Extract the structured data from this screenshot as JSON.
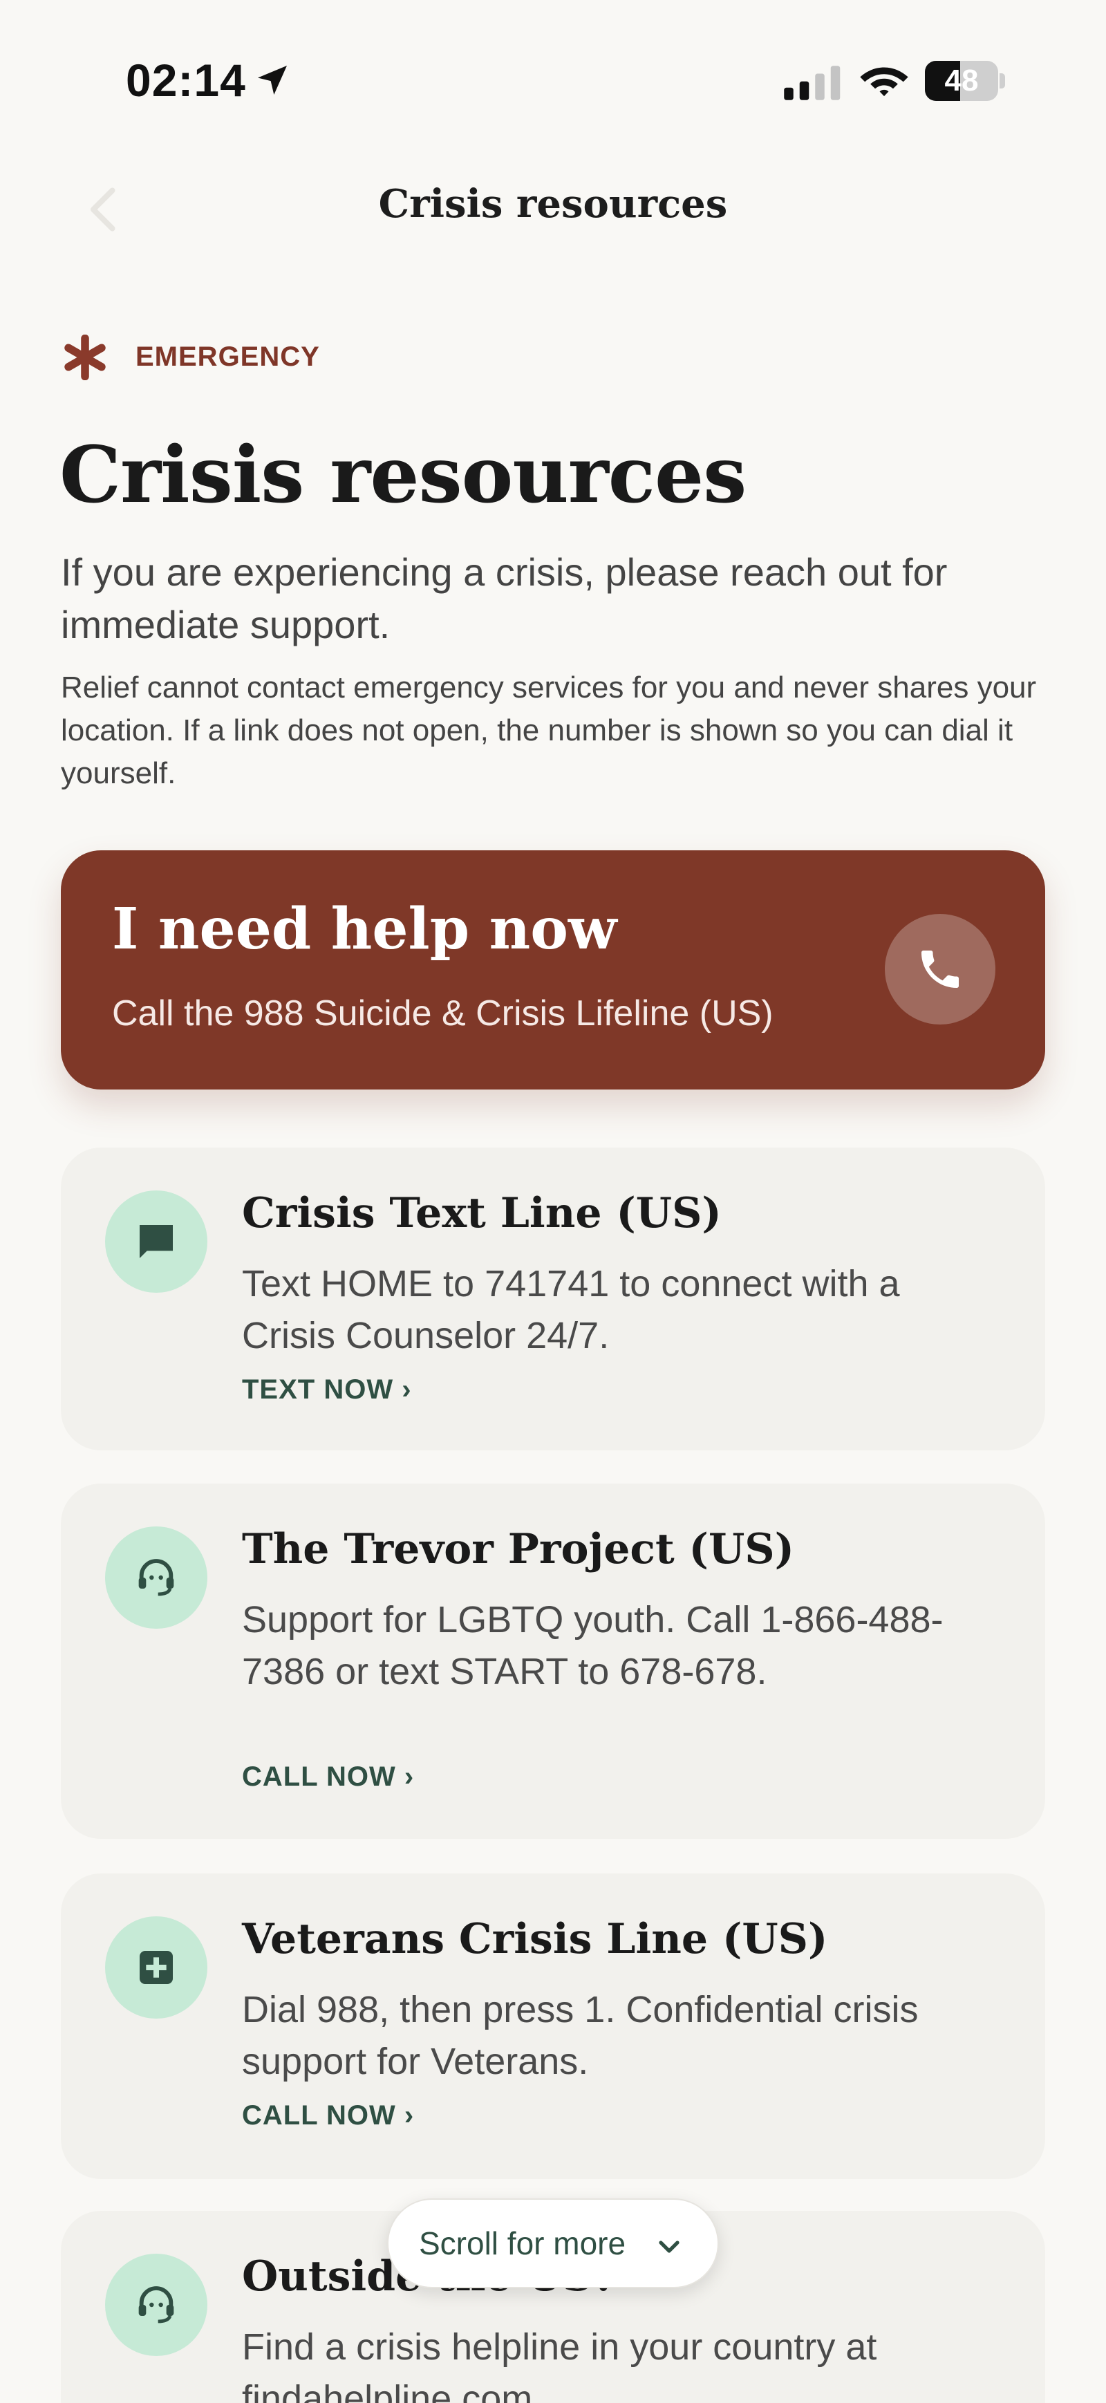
{
  "status_bar": {
    "time": "02:14",
    "battery": "48",
    "battery_level": 0.48,
    "icons": [
      "location-arrow-icon",
      "cellular-signal-icon",
      "wifi-icon",
      "battery-icon"
    ]
  },
  "nav": {
    "title": "Crisis resources",
    "back_icon": "chevron-left-icon"
  },
  "header": {
    "label": "EMERGENCY",
    "label_icon": "asterisk-icon",
    "title": "Crisis resources",
    "intro": "If you are experiencing a crisis, please reach out for immediate support.",
    "disclaimer": "Relief cannot contact emergency services for you and never shares your location. If a link does not open, the number is shown so you can dial it yourself."
  },
  "help_now": {
    "title": "I need help now",
    "subtitle": "Call the 988 Suicide & Crisis Lifeline (US)",
    "icon": "phone-icon"
  },
  "resources": [
    {
      "title": "Crisis Text Line (US)",
      "description": "Text HOME to 741741 to connect with a Crisis Counselor 24/7.",
      "action": "TEXT NOW ›",
      "icon": "chat-bubble-icon"
    },
    {
      "title": "The Trevor Project (US)",
      "description": "Support for LGBTQ youth. Call 1-866-488-7386 or text START to 678-678.",
      "action": "CALL NOW ›",
      "icon": "headset-icon"
    },
    {
      "title": "Veterans Crisis Line (US)",
      "description": "Dial 988, then press 1. Confidential crisis support for Veterans.",
      "action": "CALL NOW ›",
      "icon": "medical-cross-icon"
    },
    {
      "title": "Outside the US?",
      "description": "Find a crisis helpline in your country at findahelpline.com.",
      "icon": "headset-icon"
    }
  ],
  "scroll_hint": {
    "label": "Scroll for more",
    "icon": "chevron-down-icon"
  },
  "colors": {
    "background": "#f9f8f5",
    "accent": "#7f3828",
    "card": "#f2f1ed",
    "icon_circle": "#c6ead6",
    "action_text": "#2f4f43"
  }
}
